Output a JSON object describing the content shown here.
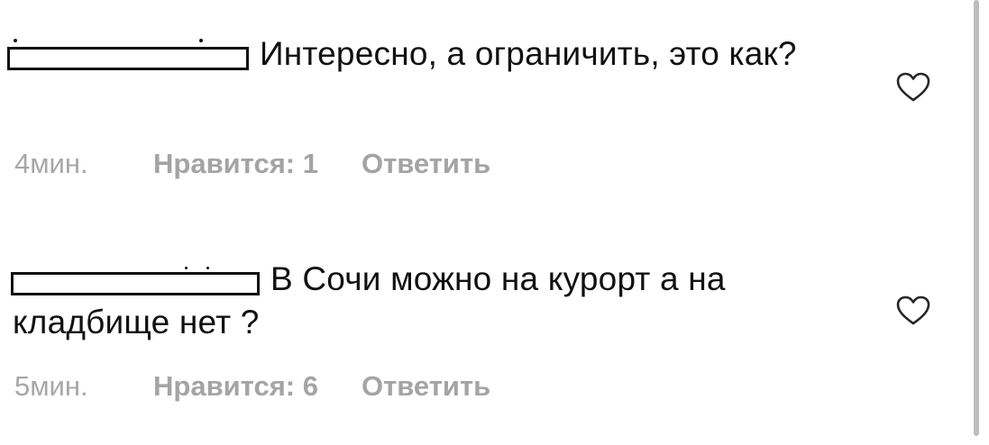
{
  "comments": [
    {
      "username_redacted": true,
      "text": "Интересно, а ограничить, это как?",
      "time": "4мин.",
      "likes_label": "Нравится: 1",
      "reply_label": "Ответить",
      "like_icon": "heart-outline-icon"
    },
    {
      "username_redacted": true,
      "text": "В Сочи можно на курорт а на кладбище нет ?",
      "time": "5мин.",
      "likes_label": "Нравится: 6",
      "reply_label": "Ответить",
      "like_icon": "heart-outline-icon"
    }
  ],
  "colors": {
    "text": "#111111",
    "meta": "#a7a7a7",
    "scrollbar": "#bdbdbd"
  }
}
